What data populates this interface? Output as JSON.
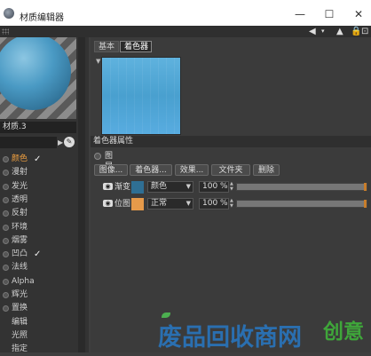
{
  "window": {
    "title": "材质编辑器",
    "controls": [
      "—",
      "☐",
      "✕"
    ]
  },
  "toolbar": {
    "icons": [
      "back-arrow-icon",
      "up-arrow-icon",
      "lock-icon",
      "expand-icon"
    ]
  },
  "preview": {
    "material_name": "材质.3"
  },
  "channels": [
    {
      "label": "颜色",
      "checked": true,
      "active": true,
      "radio": true
    },
    {
      "label": "漫射",
      "checked": false,
      "active": false,
      "radio": true
    },
    {
      "label": "发光",
      "checked": false,
      "active": false,
      "radio": true
    },
    {
      "label": "透明",
      "checked": false,
      "active": false,
      "radio": true
    },
    {
      "label": "反射",
      "checked": false,
      "active": false,
      "radio": true
    },
    {
      "label": "环境",
      "checked": false,
      "active": false,
      "radio": true
    },
    {
      "label": "烟雾",
      "checked": false,
      "active": false,
      "radio": true
    },
    {
      "label": "凹凸",
      "checked": true,
      "active": false,
      "radio": true
    },
    {
      "label": "法线",
      "checked": false,
      "active": false,
      "radio": true
    },
    {
      "label": "Alpha",
      "checked": false,
      "active": false,
      "radio": true
    },
    {
      "label": "辉光",
      "checked": false,
      "active": false,
      "radio": true
    },
    {
      "label": "置换",
      "checked": false,
      "active": false,
      "radio": true
    },
    {
      "label": "编辑",
      "checked": false,
      "active": false,
      "radio": false
    },
    {
      "label": "光照",
      "checked": false,
      "active": false,
      "radio": false
    },
    {
      "label": "指定",
      "checked": false,
      "active": false,
      "radio": false
    }
  ],
  "tabs": [
    {
      "label": "基本",
      "selected": false
    },
    {
      "label": "着色器",
      "selected": true
    }
  ],
  "shader": {
    "section_title": "着色器属性",
    "layer_label": "图层",
    "buttons": [
      "图像...",
      "着色器...",
      "效果...",
      "文件夹",
      "删除"
    ],
    "layers": [
      {
        "name": "渐变",
        "swatch_color": "#2f6f94",
        "mode": "颜色",
        "percent": "100 %",
        "level": 1.0
      },
      {
        "name": "位图",
        "swatch_color": "#e69a4a",
        "mode": "正常",
        "percent": "100 %",
        "level": 1.0
      }
    ]
  },
  "watermark": {
    "text": "废品回收商网",
    "text2": "创意"
  }
}
